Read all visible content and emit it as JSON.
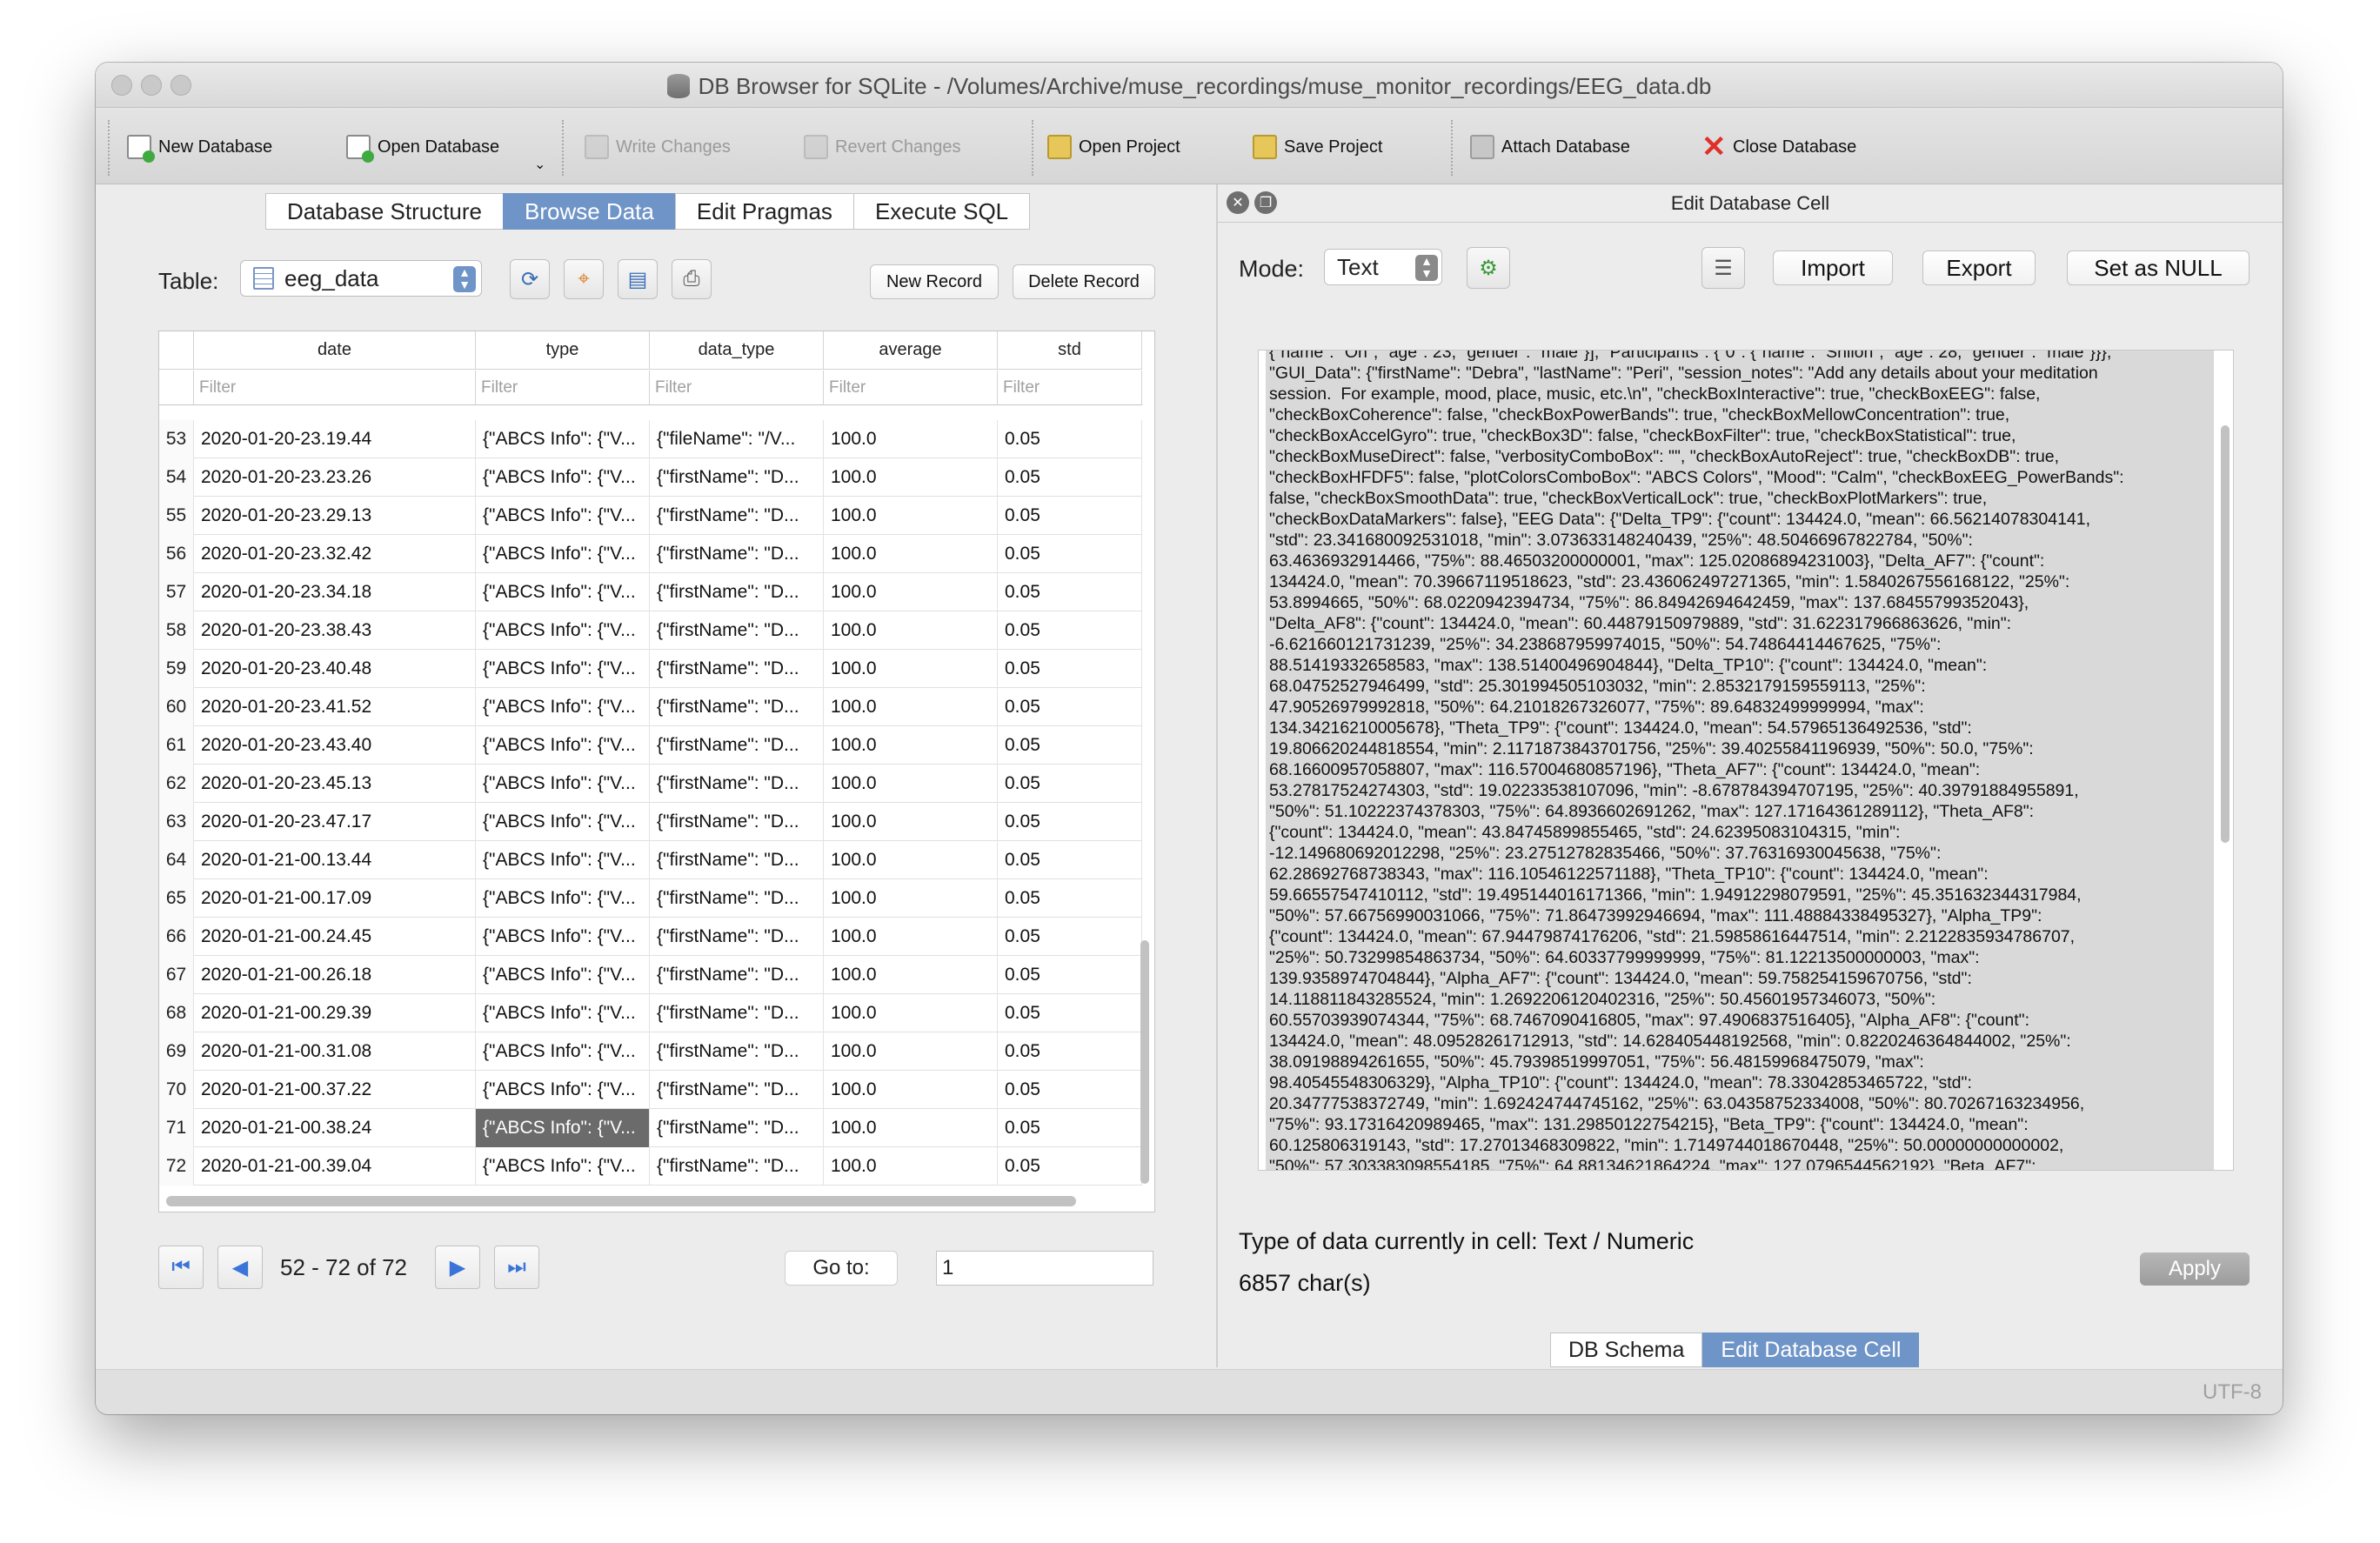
{
  "window": {
    "title": "DB Browser for SQLite - /Volumes/Archive/muse_recordings/muse_monitor_recordings/EEG_data.db"
  },
  "toolbar": {
    "new_db": "New Database",
    "open_db": "Open Database",
    "write_changes": "Write Changes",
    "revert_changes": "Revert Changes",
    "open_project": "Open Project",
    "save_project": "Save Project",
    "attach_db": "Attach Database",
    "close_db": "Close Database"
  },
  "main_tabs": [
    "Database Structure",
    "Browse Data",
    "Edit Pragmas",
    "Execute SQL"
  ],
  "browse": {
    "table_label": "Table:",
    "table_name": "eeg_data",
    "new_record": "New Record",
    "delete_record": "Delete Record",
    "columns": [
      "date",
      "type",
      "data_type",
      "average",
      "std"
    ],
    "filter_placeholder": "Filter",
    "rows": [
      {
        "n": "53",
        "date": "2020-01-20-23.19.44",
        "type": "{\"ABCS Info\": {\"V...",
        "data_type": "{\"fileName\": \"/V...",
        "average": "100.0",
        "std": "0.05"
      },
      {
        "n": "54",
        "date": "2020-01-20-23.23.26",
        "type": "{\"ABCS Info\": {\"V...",
        "data_type": "{\"firstName\": \"D...",
        "average": "100.0",
        "std": "0.05"
      },
      {
        "n": "55",
        "date": "2020-01-20-23.29.13",
        "type": "{\"ABCS Info\": {\"V...",
        "data_type": "{\"firstName\": \"D...",
        "average": "100.0",
        "std": "0.05"
      },
      {
        "n": "56",
        "date": "2020-01-20-23.32.42",
        "type": "{\"ABCS Info\": {\"V...",
        "data_type": "{\"firstName\": \"D...",
        "average": "100.0",
        "std": "0.05"
      },
      {
        "n": "57",
        "date": "2020-01-20-23.34.18",
        "type": "{\"ABCS Info\": {\"V...",
        "data_type": "{\"firstName\": \"D...",
        "average": "100.0",
        "std": "0.05"
      },
      {
        "n": "58",
        "date": "2020-01-20-23.38.43",
        "type": "{\"ABCS Info\": {\"V...",
        "data_type": "{\"firstName\": \"D...",
        "average": "100.0",
        "std": "0.05"
      },
      {
        "n": "59",
        "date": "2020-01-20-23.40.48",
        "type": "{\"ABCS Info\": {\"V...",
        "data_type": "{\"firstName\": \"D...",
        "average": "100.0",
        "std": "0.05"
      },
      {
        "n": "60",
        "date": "2020-01-20-23.41.52",
        "type": "{\"ABCS Info\": {\"V...",
        "data_type": "{\"firstName\": \"D...",
        "average": "100.0",
        "std": "0.05"
      },
      {
        "n": "61",
        "date": "2020-01-20-23.43.40",
        "type": "{\"ABCS Info\": {\"V...",
        "data_type": "{\"firstName\": \"D...",
        "average": "100.0",
        "std": "0.05"
      },
      {
        "n": "62",
        "date": "2020-01-20-23.45.13",
        "type": "{\"ABCS Info\": {\"V...",
        "data_type": "{\"firstName\": \"D...",
        "average": "100.0",
        "std": "0.05"
      },
      {
        "n": "63",
        "date": "2020-01-20-23.47.17",
        "type": "{\"ABCS Info\": {\"V...",
        "data_type": "{\"firstName\": \"D...",
        "average": "100.0",
        "std": "0.05"
      },
      {
        "n": "64",
        "date": "2020-01-21-00.13.44",
        "type": "{\"ABCS Info\": {\"V...",
        "data_type": "{\"firstName\": \"D...",
        "average": "100.0",
        "std": "0.05"
      },
      {
        "n": "65",
        "date": "2020-01-21-00.17.09",
        "type": "{\"ABCS Info\": {\"V...",
        "data_type": "{\"firstName\": \"D...",
        "average": "100.0",
        "std": "0.05"
      },
      {
        "n": "66",
        "date": "2020-01-21-00.24.45",
        "type": "{\"ABCS Info\": {\"V...",
        "data_type": "{\"firstName\": \"D...",
        "average": "100.0",
        "std": "0.05"
      },
      {
        "n": "67",
        "date": "2020-01-21-00.26.18",
        "type": "{\"ABCS Info\": {\"V...",
        "data_type": "{\"firstName\": \"D...",
        "average": "100.0",
        "std": "0.05"
      },
      {
        "n": "68",
        "date": "2020-01-21-00.29.39",
        "type": "{\"ABCS Info\": {\"V...",
        "data_type": "{\"firstName\": \"D...",
        "average": "100.0",
        "std": "0.05"
      },
      {
        "n": "69",
        "date": "2020-01-21-00.31.08",
        "type": "{\"ABCS Info\": {\"V...",
        "data_type": "{\"firstName\": \"D...",
        "average": "100.0",
        "std": "0.05"
      },
      {
        "n": "70",
        "date": "2020-01-21-00.37.22",
        "type": "{\"ABCS Info\": {\"V...",
        "data_type": "{\"firstName\": \"D...",
        "average": "100.0",
        "std": "0.05"
      },
      {
        "n": "71",
        "date": "2020-01-21-00.38.24",
        "type": "{\"ABCS Info\": {\"V...",
        "data_type": "{\"firstName\": \"D...",
        "average": "100.0",
        "std": "0.05",
        "selected": true
      },
      {
        "n": "72",
        "date": "2020-01-21-00.39.04",
        "type": "{\"ABCS Info\": {\"V...",
        "data_type": "{\"firstName\": \"D...",
        "average": "100.0",
        "std": "0.05"
      }
    ],
    "pager": "52 - 72 of 72",
    "goto_label": "Go to:",
    "goto_value": "1"
  },
  "edit_cell": {
    "title": "Edit Database Cell",
    "mode_label": "Mode:",
    "mode_value": "Text",
    "import": "Import",
    "export": "Export",
    "set_null": "Set as NULL",
    "content": "{\"name\": \"Oh\", \"age\": 23, \"gender\": \"male\"}], \"Participants\": {\"0\": {\"name\": \"Shilon\", \"age\": 28, \"gender\": \"male\"}}},\n\"GUI_Data\": {\"firstName\": \"Debra\", \"lastName\": \"Peri\", \"session_notes\": \"Add any details about your meditation\nsession.  For example, mood, place, music, etc.\\n\", \"checkBoxInteractive\": true, \"checkBoxEEG\": false,\n\"checkBoxCoherence\": false, \"checkBoxPowerBands\": true, \"checkBoxMellowConcentration\": true,\n\"checkBoxAccelGyro\": true, \"checkBox3D\": false, \"checkBoxFilter\": true, \"checkBoxStatistical\": true,\n\"checkBoxMuseDirect\": false, \"verbosityComboBox\": \"\", \"checkBoxAutoReject\": true, \"checkBoxDB\": true,\n\"checkBoxHFDF5\": false, \"plotColorsComboBox\": \"ABCS Colors\", \"Mood\": \"Calm\", \"checkBoxEEG_PowerBands\":\nfalse, \"checkBoxSmoothData\": true, \"checkBoxVerticalLock\": true, \"checkBoxPlotMarkers\": true,\n\"checkBoxDataMarkers\": false}, \"EEG Data\": {\"Delta_TP9\": {\"count\": 134424.0, \"mean\": 66.56214078304141,\n\"std\": 23.341680092531018, \"min\": 3.073633148240439, \"25%\": 48.50466967822784, \"50%\":\n63.4636932914466, \"75%\": 88.46503200000001, \"max\": 125.02086894231003}, \"Delta_AF7\": {\"count\":\n134424.0, \"mean\": 70.39667119518623, \"std\": 23.436062497271365, \"min\": 1.5840267556168122, \"25%\":\n53.8994665, \"50%\": 68.0220942394734, \"75%\": 86.84942694642459, \"max\": 137.68455799352043},\n\"Delta_AF8\": {\"count\": 134424.0, \"mean\": 60.44879150979889, \"std\": 31.622317966863626, \"min\":\n-6.621660121731239, \"25%\": 34.238687959974015, \"50%\": 54.74864414467625, \"75%\":\n88.51419332658583, \"max\": 138.51400496904844}, \"Delta_TP10\": {\"count\": 134424.0, \"mean\":\n68.04752527946499, \"std\": 25.301994505103032, \"min\": 2.8532179159559113, \"25%\":\n47.90526979992818, \"50%\": 64.21018267326077, \"75%\": 89.64832499999994, \"max\":\n134.34216210005678}, \"Theta_TP9\": {\"count\": 134424.0, \"mean\": 54.57965136492536, \"std\":\n19.806620244818554, \"min\": 2.1171873843701756, \"25%\": 39.40255841196939, \"50%\": 50.0, \"75%\":\n68.16600957058807, \"max\": 116.57004680857196}, \"Theta_AF7\": {\"count\": 134424.0, \"mean\":\n53.27817524274303, \"std\": 19.02233538107096, \"min\": -8.678784394707195, \"25%\": 40.39791884955891,\n\"50%\": 51.10222374378303, \"75%\": 64.8936602691262, \"max\": 127.17164361289112}, \"Theta_AF8\":\n{\"count\": 134424.0, \"mean\": 43.84745899855465, \"std\": 24.62395083104315, \"min\":\n-12.149680692012298, \"25%\": 23.27512782835466, \"50%\": 37.76316930045638, \"75%\":\n62.28692768738343, \"max\": 116.10546122571188}, \"Theta_TP10\": {\"count\": 134424.0, \"mean\":\n59.66557547410112, \"std\": 19.495144016171366, \"min\": 1.94912298079591, \"25%\": 45.351632344317984,\n\"50%\": 57.66756990031066, \"75%\": 71.86473992946694, \"max\": 111.48884338495327}, \"Alpha_TP9\":\n{\"count\": 134424.0, \"mean\": 67.94479874176206, \"std\": 21.59858616447514, \"min\": 2.2122835934786707,\n\"25%\": 50.73299854863734, \"50%\": 64.60337799999999, \"75%\": 81.12213500000003, \"max\":\n139.9358974704844}, \"Alpha_AF7\": {\"count\": 134424.0, \"mean\": 59.758254159670756, \"std\":\n14.118811843285524, \"min\": 1.2692206120402316, \"25%\": 50.45601957346073, \"50%\":\n60.55703939074344, \"75%\": 68.7467090416805, \"max\": 97.4906837516405}, \"Alpha_AF8\": {\"count\":\n134424.0, \"mean\": 48.09528261712913, \"std\": 14.628405448192568, \"min\": 0.8220246364844002, \"25%\":\n38.09198894261655, \"50%\": 45.79398519997051, \"75%\": 56.48159968475079, \"max\":\n98.40545548306329}, \"Alpha_TP10\": {\"count\": 134424.0, \"mean\": 78.33042853465722, \"std\":\n20.34777538372749, \"min\": 1.692424744745162, \"25%\": 63.04358752334008, \"50%\": 80.70267163234956,\n\"75%\": 93.17316420989465, \"max\": 131.29850122754215}, \"Beta_TP9\": {\"count\": 134424.0, \"mean\":\n60.125806319143, \"std\": 17.27013468309822, \"min\": 1.7149744018670448, \"25%\": 50.00000000000002,\n\"50%\": 57.303383098554185, \"75%\": 64.88134621864224, \"max\": 127.0796544562192}, \"Beta_AF7\":",
    "type_info": "Type of data currently in cell: Text / Numeric",
    "char_count": "6857 char(s)",
    "apply": "Apply"
  },
  "bottom_tabs": [
    "DB Schema",
    "Edit Database Cell"
  ],
  "status": {
    "encoding": "UTF-8"
  }
}
